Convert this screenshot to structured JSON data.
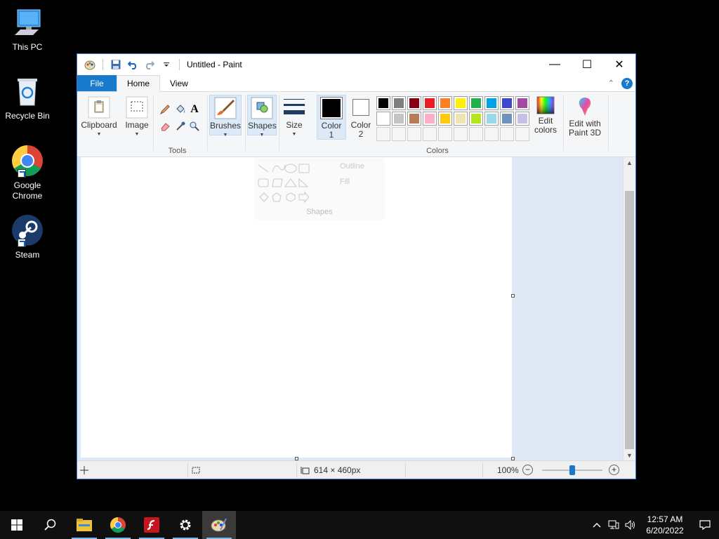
{
  "desktop": {
    "icons": [
      {
        "label": "This PC",
        "icon": "computer-icon"
      },
      {
        "label": "Recycle Bin",
        "icon": "recycle-bin-icon"
      },
      {
        "label": "Google Chrome",
        "icon": "chrome-icon"
      },
      {
        "label": "Steam",
        "icon": "steam-icon"
      }
    ]
  },
  "window": {
    "title": "Untitled - Paint",
    "controls": {
      "minimize": "—",
      "maximize": "☐",
      "close": "✕"
    }
  },
  "tabs": {
    "file": "File",
    "home": "Home",
    "view": "View",
    "collapse": "⌃",
    "help": "?"
  },
  "ribbon": {
    "clipboard": {
      "label": "Clipboard"
    },
    "image": {
      "label": "Image"
    },
    "tools_label": "Tools",
    "text_tool": "A",
    "brushes": {
      "label": "Brushes"
    },
    "shapes": {
      "label": "Shapes"
    },
    "size": {
      "label": "Size"
    },
    "color1": {
      "label_line1": "Color",
      "label_line2": "1",
      "color": "#000000"
    },
    "color2": {
      "label_line1": "Color",
      "label_line2": "2",
      "color": "#ffffff"
    },
    "colors_label": "Colors",
    "edit_colors": {
      "line1": "Edit",
      "line2": "colors"
    },
    "paint3d": {
      "line1": "Edit with",
      "line2": "Paint 3D"
    },
    "palette_row1": [
      "#000000",
      "#7f7f7f",
      "#880015",
      "#ed1c24",
      "#ff7f27",
      "#fff200",
      "#22b14c",
      "#00a2e8",
      "#3f48cc",
      "#a349a4"
    ],
    "palette_row2": [
      "#ffffff",
      "#c3c3c3",
      "#b97a57",
      "#ffaec9",
      "#ffc90e",
      "#efe4b0",
      "#b5e61d",
      "#99d9ea",
      "#7092be",
      "#c8bfe7"
    ]
  },
  "shapes_panel": {
    "outline": "Outline",
    "fill": "Fill",
    "label": "Shapes"
  },
  "status": {
    "dimensions": "614 × 460px",
    "zoom": "100%",
    "zoom_level": 0.5
  },
  "taskbar": {
    "apps": [
      "start-icon",
      "search-icon",
      "file-explorer-icon",
      "chrome-icon",
      "flash-icon",
      "settings-icon",
      "paint-icon"
    ],
    "time": "12:57 AM",
    "date": "6/20/2022"
  }
}
